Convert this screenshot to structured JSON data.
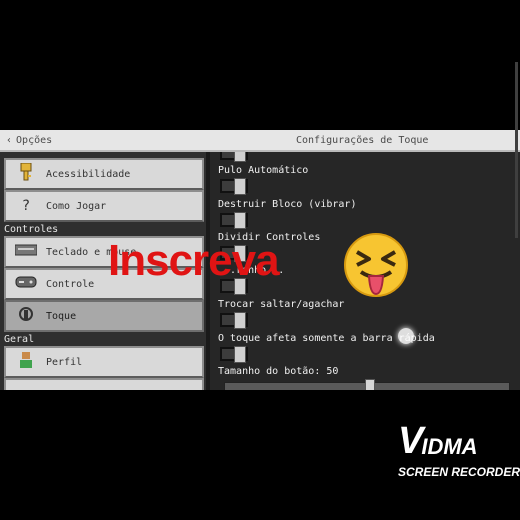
{
  "topbar": {
    "back_label": "Opções",
    "title": "Configurações de Toque"
  },
  "sidebar": {
    "items_top": [
      {
        "label": "Acessibilidade",
        "icon": "key-icon"
      },
      {
        "label": "Como Jogar",
        "icon": "question-icon"
      }
    ],
    "section_controls": "Controles",
    "items_controls": [
      {
        "label": "Teclado e mouse",
        "icon": "keyboard-icon"
      },
      {
        "label": "Controle",
        "icon": "gamepad-icon"
      },
      {
        "label": "Toque",
        "icon": "touch-icon",
        "active": true
      }
    ],
    "section_general": "Geral",
    "items_general": [
      {
        "label": "Perfil",
        "icon": "profile-icon"
      }
    ]
  },
  "settings": {
    "options": [
      {
        "label": "Pulo Automático"
      },
      {
        "label": "Destruir Bloco (vibrar)"
      },
      {
        "label": "Dividir Controles"
      },
      {
        "label": "...ranho..."
      },
      {
        "label": "Trocar saltar/agachar"
      },
      {
        "label": "O toque afeta somente a barra rápida"
      }
    ],
    "slider_label": "Tamanho do botão: 50",
    "slider_value": 50
  },
  "overlay": {
    "text": "Inscreva"
  },
  "watermark": {
    "brand_v": "V",
    "brand_rest": "IDMA",
    "subtitle": "SCREEN RECORDER"
  },
  "colors": {
    "overlay_text": "#e01414",
    "panel": "#d9d9d9",
    "background": "#262626"
  }
}
